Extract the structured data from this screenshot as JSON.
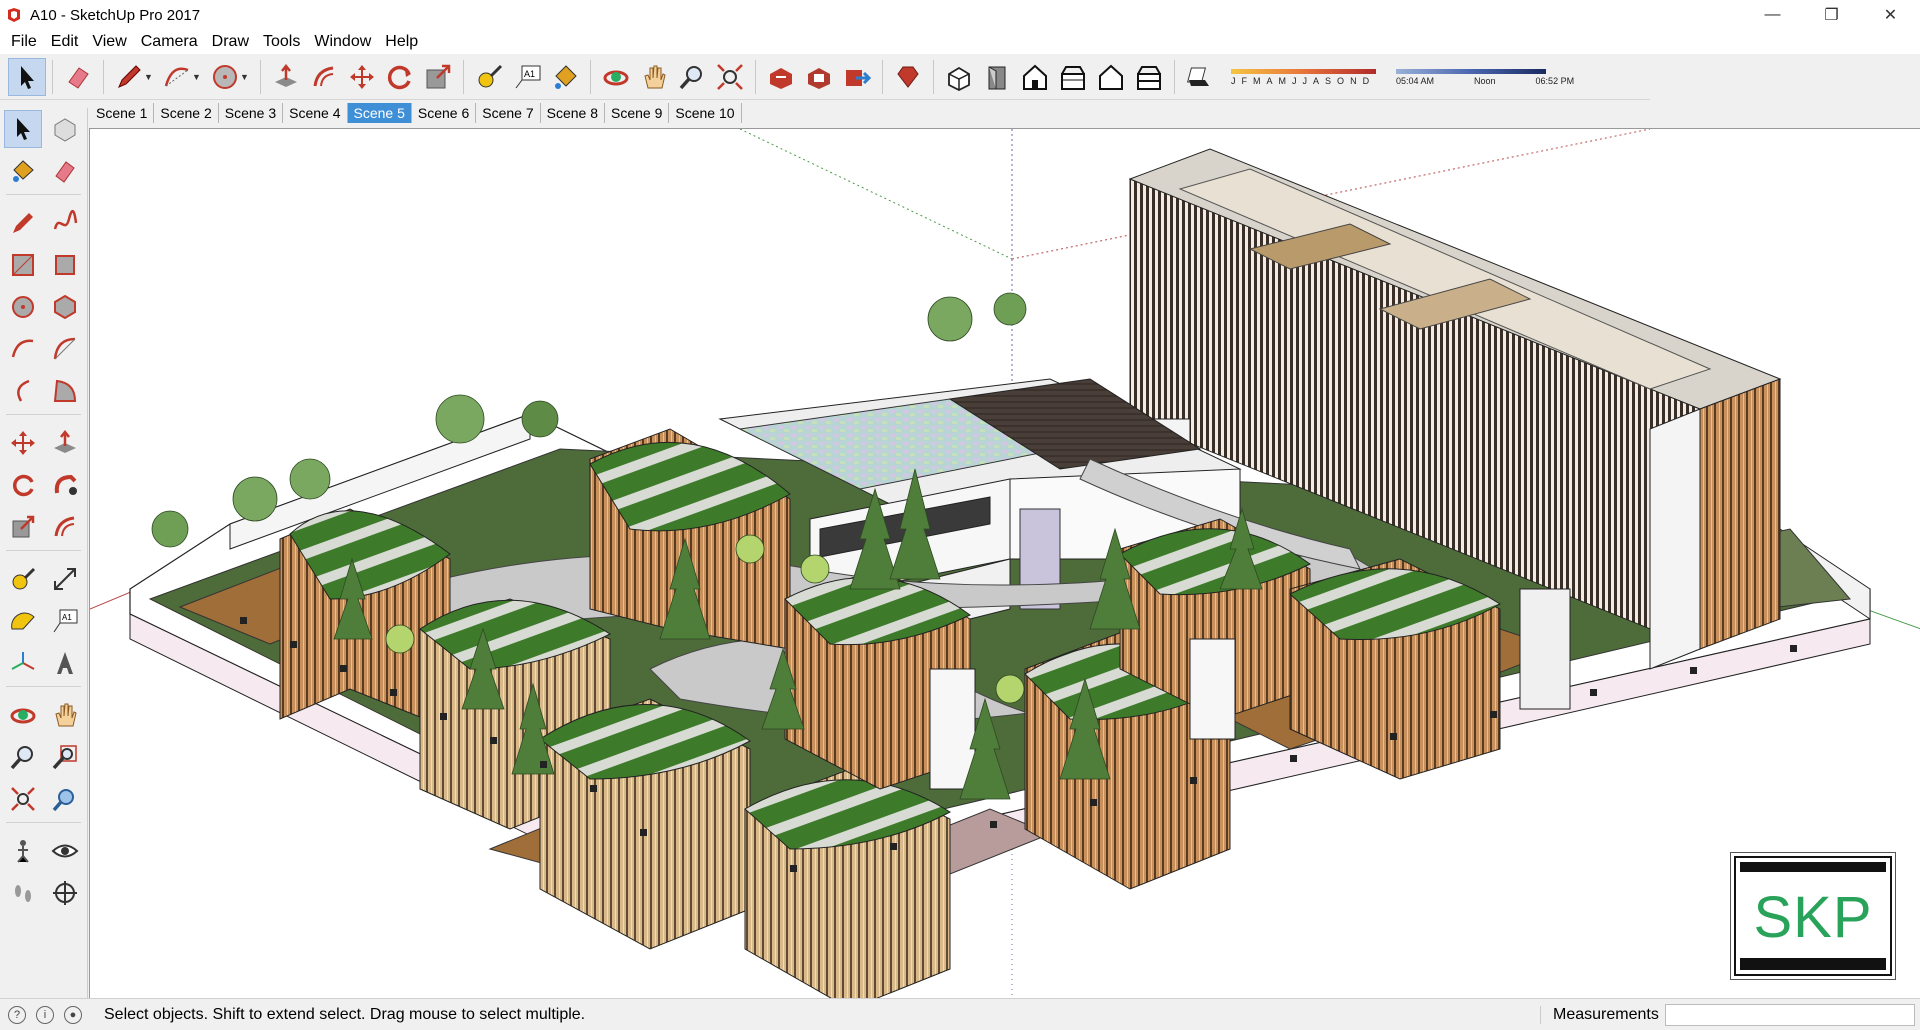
{
  "window": {
    "title": "A10 - SketchUp Pro 2017"
  },
  "menu": [
    "File",
    "Edit",
    "View",
    "Camera",
    "Draw",
    "Tools",
    "Window",
    "Help"
  ],
  "scenes": [
    "Scene 1",
    "Scene 2",
    "Scene 3",
    "Scene 4",
    "Scene 5",
    "Scene 6",
    "Scene 7",
    "Scene 8",
    "Scene 9",
    "Scene 10"
  ],
  "active_scene": "Scene 5",
  "shadow": {
    "months": [
      "J",
      "F",
      "M",
      "A",
      "M",
      "J",
      "J",
      "A",
      "S",
      "O",
      "N",
      "D"
    ],
    "time_start": "05:04 AM",
    "time_mid": "Noon",
    "time_end": "06:52 PM"
  },
  "toolbar_icons": [
    "select-icon",
    "eraser-icon",
    "pencil-icon",
    "arc-icon",
    "shapes-icon",
    "push-pull-icon",
    "offset-icon",
    "move-icon",
    "rotate-icon",
    "scale-icon",
    "tape-measure-icon",
    "text-icon",
    "paint-bucket-icon",
    "orbit-icon",
    "pan-icon",
    "zoom-icon",
    "zoom-extents-icon",
    "warehouse-icon",
    "extension-warehouse-icon",
    "share-model-icon",
    "ruby-icon",
    "iso-view-icon",
    "top-view-icon",
    "front-view-icon",
    "right-view-icon",
    "back-view-icon",
    "left-view-icon",
    "shadows-icon"
  ],
  "status": {
    "hint": "Select objects. Shift to extend select. Drag mouse to select multiple.",
    "measurements_label": "Measurements",
    "measurements_value": ""
  },
  "logo": {
    "text": "SKP",
    "color": "#2aa35a"
  },
  "colors": {
    "scene_active": "#3f8fd6",
    "green_roof": "#3d7a2a",
    "cladding": "#a0673a"
  }
}
